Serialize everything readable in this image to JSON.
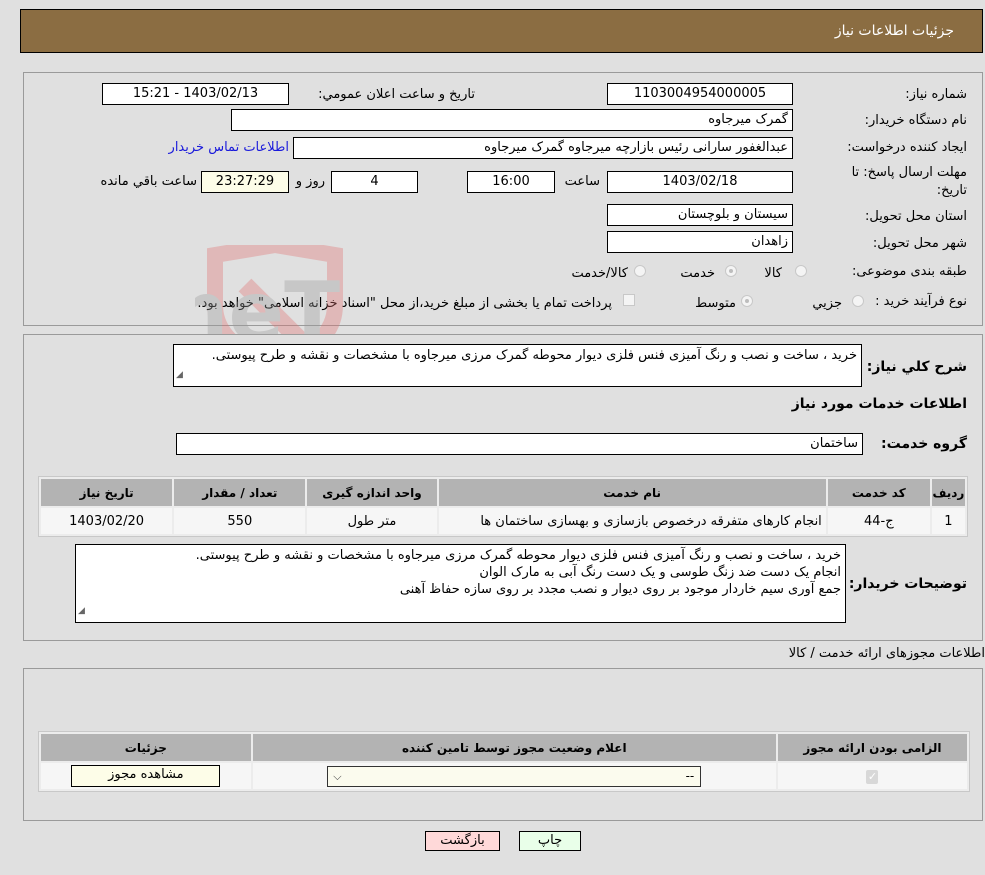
{
  "header": {
    "title": "جزئیات اطلاعات نیاز"
  },
  "info": {
    "need_number_label": "شماره نیاز:",
    "need_number": "1103004954000005",
    "announce_label": "تاریخ و ساعت اعلان عمومي:",
    "announce_value": "1403/02/13 - 15:21",
    "buyer_org_label": "نام دستگاه خریدار:",
    "buyer_org": "گمرک میرجاوه",
    "creator_label": "ایجاد کننده درخواست:",
    "creator": "عبدالغفور سارانی رئیس بازارچه میرجاوه گمرک میرجاوه",
    "contact_link": "اطلاعات تماس خریدار",
    "deadline_label_1": "مهلت ارسال پاسخ: تا",
    "deadline_label_2": "تاریخ:",
    "deadline_date": "1403/02/18",
    "time_label": "ساعت",
    "deadline_time": "16:00",
    "days_value": "4",
    "days_label": "روز و",
    "remaining_time": "23:27:29",
    "remaining_label": "ساعت باقي مانده",
    "province_label": "استان محل تحویل:",
    "province": "سیستان و بلوچستان",
    "city_label": "شهر محل تحویل:",
    "city": "زاهدان",
    "category_label": "طبقه بندی موضوعی:",
    "category_options": [
      "کالا",
      "خدمت",
      "کالا/خدمت"
    ],
    "category_selected": "خدمت",
    "process_label": "نوع فرآیند خرید :",
    "process_options": [
      "جزيي",
      "متوسط"
    ],
    "process_selected": "متوسط",
    "treasury_note": "پرداخت تمام یا بخشی از مبلغ خرید،از محل \"اسناد خزانه اسلامی\" خواهد بود."
  },
  "description": {
    "label": "شرح کلي نیاز:",
    "text": "خرید ، ساخت و نصب و رنگ آمیزی فنس فلزی دیوار محوطه گمرک مرزی میرجاوه با مشخصات و نقشه و طرح پیوستی.",
    "services_heading": "اطلاعات خدمات مورد نیاز",
    "group_label": "گروه خدمت:",
    "group_value": "ساختمان"
  },
  "services_table": {
    "headers": [
      "ردیف",
      "کد خدمت",
      "نام خدمت",
      "واحد اندازه گیری",
      "تعداد / مقدار",
      "تاریخ نیاز"
    ],
    "rows": [
      [
        "1",
        "ج-44",
        "انجام کارهای متفرقه درخصوص بازسازی و بهسازی ساختمان ها",
        "متر طول",
        "550",
        "1403/02/20"
      ]
    ]
  },
  "buyer_notes": {
    "label": "توضیحات خریدار:",
    "lines": [
      "خرید ، ساخت و نصب و رنگ آمیزی فنس فلزی دیوار محوطه گمرک مرزی میرجاوه با مشخصات و نقشه و طرح  پیوستی.",
      "انجام یک دست ضد زنگ طوسی و یک دست رنگ آبی به مارک الوان",
      "جمع آوری سیم خاردار موجود بر روی دیوار و نصب مجدد بر روی سازه حفاظ آهنی"
    ]
  },
  "permits": {
    "title": "اطلاعات مجوزهای ارائه خدمت / کالا",
    "headers": [
      "الزامی بودن ارائه مجوز",
      "اعلام وضعیت مجوز توسط تامین کننده",
      "جزئیات"
    ],
    "row": {
      "required_checked": true,
      "status_value": "--",
      "details_button": "مشاهده مجوز"
    }
  },
  "footer": {
    "print_button": "چاپ",
    "back_button": "بازگشت"
  },
  "watermark": {
    "text": "AriaTender.neT"
  },
  "colors": {
    "header_bg": "#8b6d42",
    "back_bg": "#ffd9d9",
    "print_bg": "#e9ffe9",
    "link": "#1a1adb"
  }
}
